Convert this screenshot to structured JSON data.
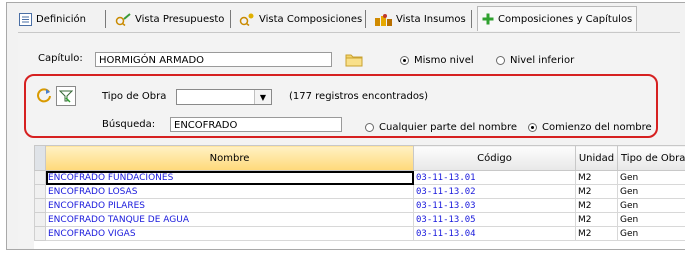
{
  "tabs": [
    {
      "label": "Definición",
      "icon": "definition-icon"
    },
    {
      "label": "Vista Presupuesto",
      "icon": "budget-view-icon"
    },
    {
      "label": "Vista Composiciones",
      "icon": "compositions-view-icon"
    },
    {
      "label": "Vista Insumos",
      "icon": "supplies-view-icon"
    },
    {
      "label": "Composiciones y Capítulos",
      "icon": "add-plus-icon"
    }
  ],
  "chapter": {
    "label": "Capítulo:",
    "value": "HORMIGÓN ARMADO",
    "radio_same": "Mismo nivel",
    "radio_lower": "Nivel inferior"
  },
  "filter": {
    "work_type_label": "Tipo de Obra",
    "work_type_value": "",
    "records_text": "(177 registros encontrados)",
    "search_label": "Búsqueda:",
    "search_value": "ENCOFRADO",
    "radio_any": "Cualquier parte del nombre",
    "radio_start": "Comienzo del nombre"
  },
  "grid": {
    "columns": [
      "Nombre",
      "Código",
      "Unidad",
      "Tipo de Obra"
    ],
    "rows": [
      {
        "nombre": "ENCOFRADO FUNDACIONES",
        "codigo": "03-11-13.01",
        "unidad": "M2",
        "tipo": "Gen"
      },
      {
        "nombre": "ENCOFRADO LOSAS",
        "codigo": "03-11-13.02",
        "unidad": "M2",
        "tipo": "Gen"
      },
      {
        "nombre": "ENCOFRADO PILARES",
        "codigo": "03-11-13.03",
        "unidad": "M2",
        "tipo": "Gen"
      },
      {
        "nombre": "ENCOFRADO TANQUE DE AGUA",
        "codigo": "03-11-13.05",
        "unidad": "M2",
        "tipo": "Gen"
      },
      {
        "nombre": "ENCOFRADO VIGAS",
        "codigo": "03-11-13.04",
        "unidad": "M2",
        "tipo": "Gen"
      }
    ]
  },
  "colors": {
    "accent": "#1a1adc",
    "highlight": "#d62020",
    "header_active": "#ffd97a"
  }
}
